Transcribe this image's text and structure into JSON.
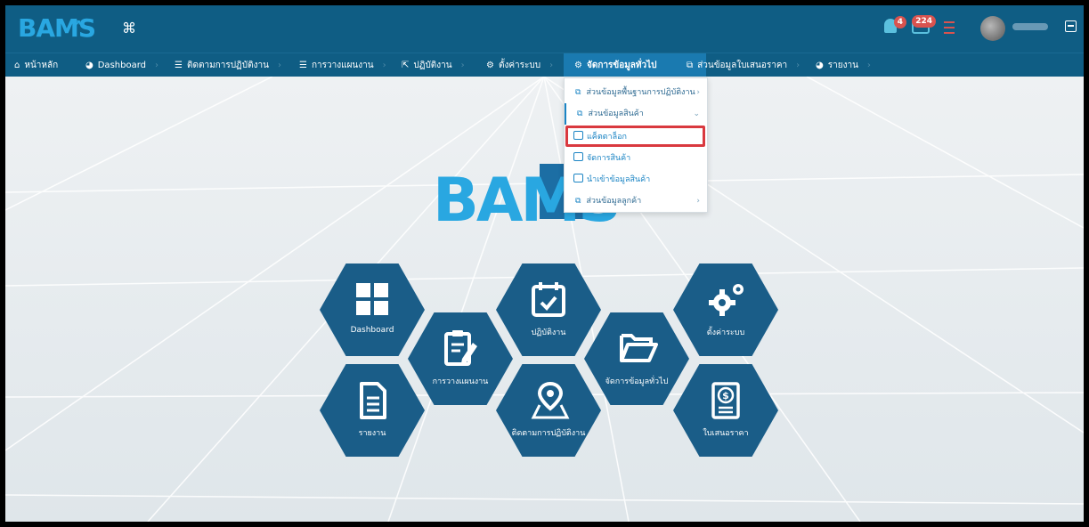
{
  "header": {
    "logo_text": "BAMS",
    "notifications_count": "4",
    "messages_count": "224"
  },
  "nav": {
    "items": [
      {
        "label": "หน้าหลัก"
      },
      {
        "label": "Dashboard"
      },
      {
        "label": "ติดตามการปฏิบัติงาน"
      },
      {
        "label": "การวางแผนงาน"
      },
      {
        "label": "ปฏิบัติงาน"
      },
      {
        "label": "ตั้งค่าระบบ"
      },
      {
        "label": "จัดการข้อมูลทั่วไป"
      },
      {
        "label": "ส่วนข้อมูลใบเสนอราคา"
      },
      {
        "label": "รายงาน"
      }
    ]
  },
  "dropdown": {
    "items": [
      {
        "label": "ส่วนข้อมูลพื้นฐานการปฏิบัติงาน"
      },
      {
        "label": "ส่วนข้อมูลสินค้า"
      },
      {
        "label": "แค็ตตาล็อก"
      },
      {
        "label": "จัดการสินค้า"
      },
      {
        "label": "นำเข้าข้อมูลสินค้า"
      },
      {
        "label": "ส่วนข้อมูลลูกค้า"
      }
    ]
  },
  "main": {
    "logo_text": "BAMS",
    "tiles": [
      {
        "label": "Dashboard",
        "icon": "grid-icon"
      },
      {
        "label": "การวางแผนงาน",
        "icon": "edit-document-icon"
      },
      {
        "label": "ปฏิบัติงาน",
        "icon": "calendar-check-icon"
      },
      {
        "label": "จัดการข้อมูลทั่วไป",
        "icon": "folder-open-icon"
      },
      {
        "label": "ตั้งค่าระบบ",
        "icon": "gears-icon"
      },
      {
        "label": "รายงาน",
        "icon": "document-icon"
      },
      {
        "label": "ติดตามการปฏิบัติงาน",
        "icon": "map-pin-icon"
      },
      {
        "label": "ใบเสนอราคา",
        "icon": "dollar-document-icon"
      }
    ]
  },
  "colors": {
    "header_bg": "#0f5d84",
    "hex_bg": "#1a5d88",
    "accent": "#29a7e1",
    "highlight_border": "#d9393f"
  }
}
